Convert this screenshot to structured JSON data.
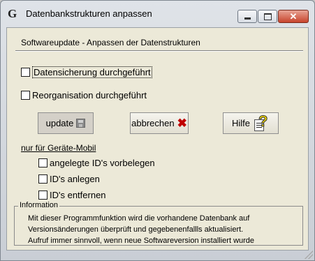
{
  "window": {
    "icon_glyph": "G",
    "title": "Datenbankstrukturen anpassen",
    "close_glyph": "✕"
  },
  "header": {
    "text": "Softwareupdate  -  Anpassen der Datenstrukturen"
  },
  "options": {
    "backup_label": "Datensicherung durchgeführt",
    "reorg_label": "Reorganisation durchgeführt"
  },
  "buttons": {
    "update_label": "update",
    "cancel_label": "abbrechen",
    "help_label": "Hilfe",
    "cancel_icon": "✖"
  },
  "mobile": {
    "section_label": "nur für Geräte-Mobil",
    "preset_ids_label": "angelegte ID's vorbelegen",
    "create_ids_label": "ID's anlegen",
    "remove_ids_label": "ID's entfernen"
  },
  "info": {
    "legend": "Information",
    "lines": [
      "Mit dieser Programmfunktion wird die vorhandene Datenbank auf",
      "Versionsänderungen überprüft und gegebenenfallls aktualisiert.",
      "Aufruf immer sinnvoll, wenn neue Softwareversion installiert wurde"
    ]
  }
}
